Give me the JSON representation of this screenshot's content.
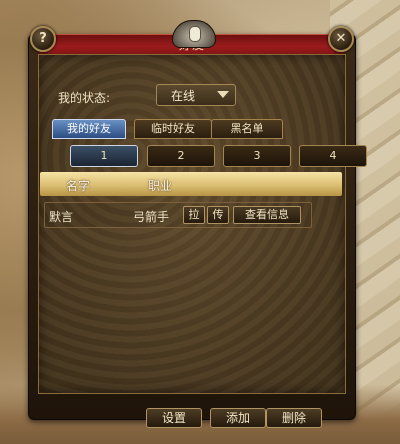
{
  "window": {
    "title": "好友",
    "help_label": "?",
    "close_label": "✕"
  },
  "status": {
    "label": "我的状态:",
    "value": "在线"
  },
  "tabs": [
    {
      "label": "我的好友",
      "active": true
    },
    {
      "label": "临时好友",
      "active": false
    },
    {
      "label": "黑名单",
      "active": false
    }
  ],
  "pages": [
    {
      "label": "1",
      "active": true
    },
    {
      "label": "2",
      "active": false
    },
    {
      "label": "3",
      "active": false
    },
    {
      "label": "4",
      "active": false
    }
  ],
  "table": {
    "headers": {
      "name": "名字",
      "job": "职业"
    },
    "rows": [
      {
        "name": "默言",
        "job": "弓箭手",
        "pull": "拉",
        "pass": "传",
        "info": "查看信息"
      }
    ]
  },
  "footer": {
    "settings": "设置",
    "add": "添加",
    "delete": "删除"
  },
  "colors": {
    "title_bar": "#9b1c1c",
    "active_tab": "#2c4d82",
    "header_band": "#d8bb6e"
  }
}
